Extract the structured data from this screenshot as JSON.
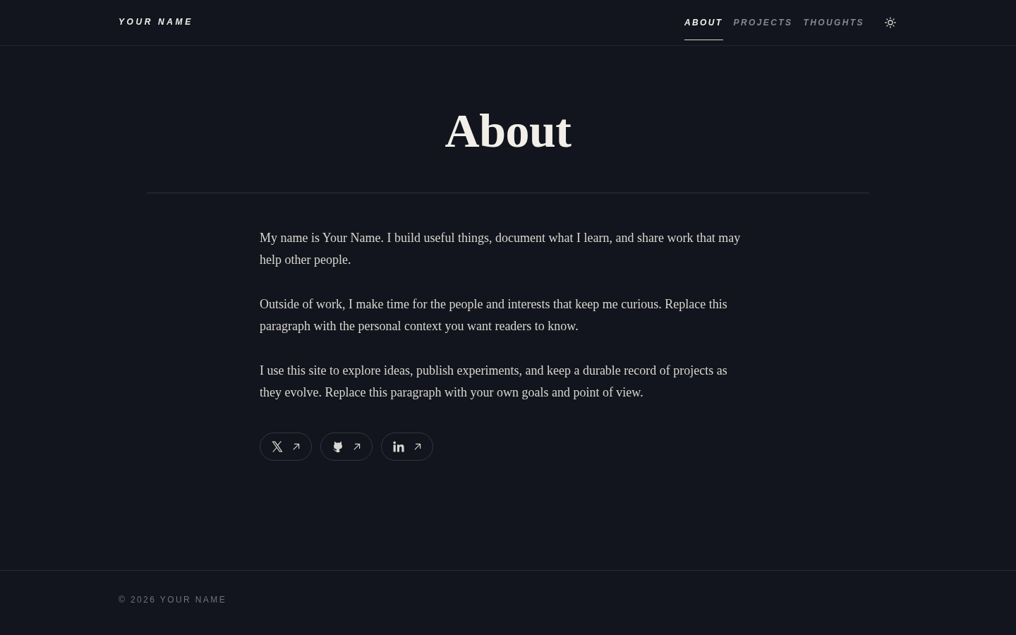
{
  "header": {
    "logo": "YOUR NAME",
    "nav": [
      {
        "label": "ABOUT",
        "selected": true
      },
      {
        "label": "PROJECTS",
        "selected": false
      },
      {
        "label": "THOUGHTS",
        "selected": false
      }
    ]
  },
  "page": {
    "title": "About",
    "paragraphs": [
      "My name is Your Name. I build useful things, document what I learn, and share work that may help other people.",
      "Outside of work, I make time for the people and interests that keep me curious. Replace this paragraph with the personal context you want readers to know.",
      "I use this site to explore ideas, publish experiments, and keep a durable record of projects as they evolve. Replace this paragraph with your own goals and point of view."
    ],
    "social_links": [
      {
        "kind": "x"
      },
      {
        "kind": "github"
      },
      {
        "kind": "linkedin"
      }
    ]
  },
  "footer": {
    "copyright": "© 2026 YOUR NAME"
  }
}
